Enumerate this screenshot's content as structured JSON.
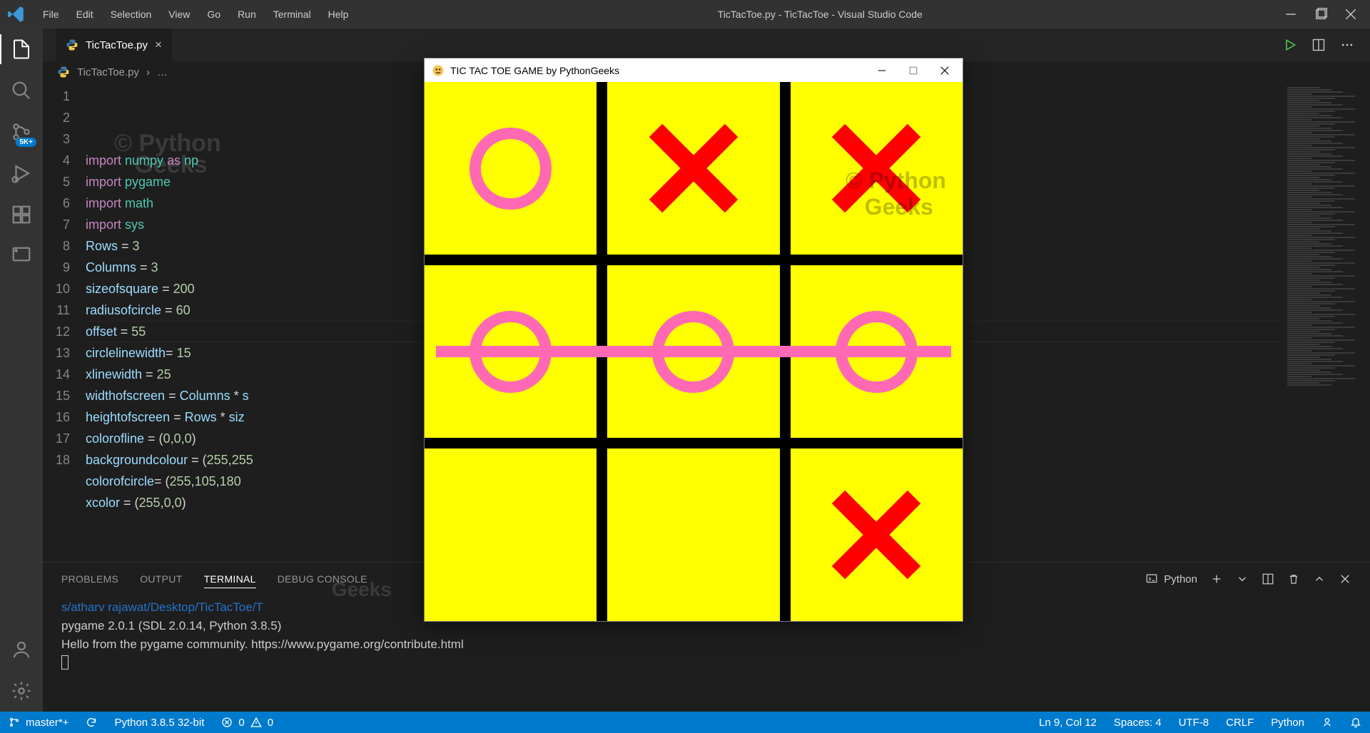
{
  "window": {
    "title": "TicTacToe.py - TicTacToe - Visual Studio Code",
    "menu": [
      "File",
      "Edit",
      "Selection",
      "View",
      "Go",
      "Run",
      "Terminal",
      "Help"
    ]
  },
  "activity": {
    "scm_badge": "5K+"
  },
  "tab": {
    "label": "TicTacToe.py"
  },
  "breadcrumb": {
    "file": "TicTacToe.py",
    "ellipsis": "…"
  },
  "code": {
    "highlight_line": 9,
    "lines": [
      {
        "n": 1,
        "tokens": [
          [
            "key",
            "import "
          ],
          [
            "mod",
            "numpy"
          ],
          [
            "op",
            " "
          ],
          [
            "key",
            "as"
          ],
          [
            "op",
            " "
          ],
          [
            "mod",
            "np"
          ]
        ]
      },
      {
        "n": 2,
        "tokens": [
          [
            "key",
            "import "
          ],
          [
            "mod",
            "pygame"
          ]
        ]
      },
      {
        "n": 3,
        "tokens": [
          [
            "key",
            "import "
          ],
          [
            "mod",
            "math"
          ]
        ]
      },
      {
        "n": 4,
        "tokens": [
          [
            "key",
            "import "
          ],
          [
            "mod",
            "sys"
          ]
        ]
      },
      {
        "n": 5,
        "tokens": [
          [
            "var",
            "Rows"
          ],
          [
            "op",
            " = "
          ],
          [
            "num",
            "3"
          ]
        ]
      },
      {
        "n": 6,
        "tokens": [
          [
            "var",
            "Columns"
          ],
          [
            "op",
            " = "
          ],
          [
            "num",
            "3"
          ]
        ]
      },
      {
        "n": 7,
        "tokens": [
          [
            "var",
            "sizeofsquare"
          ],
          [
            "op",
            " = "
          ],
          [
            "num",
            "200"
          ]
        ]
      },
      {
        "n": 8,
        "tokens": [
          [
            "var",
            "radiusofcircle"
          ],
          [
            "op",
            " = "
          ],
          [
            "num",
            "60"
          ]
        ]
      },
      {
        "n": 9,
        "tokens": [
          [
            "var",
            "offset"
          ],
          [
            "op",
            " = "
          ],
          [
            "num",
            "55"
          ]
        ]
      },
      {
        "n": 10,
        "tokens": [
          [
            "var",
            "circlelinewidth"
          ],
          [
            "op",
            "= "
          ],
          [
            "num",
            "15"
          ]
        ]
      },
      {
        "n": 11,
        "tokens": [
          [
            "var",
            "xlinewidth"
          ],
          [
            "op",
            " = "
          ],
          [
            "num",
            "25"
          ]
        ]
      },
      {
        "n": 12,
        "tokens": [
          [
            "var",
            "widthofscreen"
          ],
          [
            "op",
            " = "
          ],
          [
            "var",
            "Columns"
          ],
          [
            "op",
            " * "
          ],
          [
            "var",
            "s"
          ]
        ]
      },
      {
        "n": 13,
        "tokens": [
          [
            "var",
            "heightofscreen"
          ],
          [
            "op",
            " = "
          ],
          [
            "var",
            "Rows"
          ],
          [
            "op",
            " * "
          ],
          [
            "var",
            "siz"
          ]
        ]
      },
      {
        "n": 14,
        "tokens": [
          [
            "var",
            "colorofline"
          ],
          [
            "op",
            " = ("
          ],
          [
            "num",
            "0"
          ],
          [
            "op",
            ","
          ],
          [
            "num",
            "0"
          ],
          [
            "op",
            ","
          ],
          [
            "num",
            "0"
          ],
          [
            "op",
            ")"
          ]
        ]
      },
      {
        "n": 15,
        "tokens": [
          [
            "var",
            "backgroundcolour"
          ],
          [
            "op",
            " = ("
          ],
          [
            "num",
            "255"
          ],
          [
            "op",
            ","
          ],
          [
            "num",
            "255"
          ]
        ]
      },
      {
        "n": 16,
        "tokens": [
          [
            "var",
            "colorofcircle"
          ],
          [
            "op",
            "= ("
          ],
          [
            "num",
            "255"
          ],
          [
            "op",
            ","
          ],
          [
            "num",
            "105"
          ],
          [
            "op",
            ","
          ],
          [
            "num",
            "180"
          ]
        ]
      },
      {
        "n": 17,
        "tokens": [
          [
            "var",
            "xcolor"
          ],
          [
            "op",
            " = ("
          ],
          [
            "num",
            "255"
          ],
          [
            "op",
            ","
          ],
          [
            "num",
            "0"
          ],
          [
            "op",
            ","
          ],
          [
            "num",
            "0"
          ],
          [
            "op",
            ")"
          ]
        ]
      },
      {
        "n": 18,
        "tokens": []
      }
    ]
  },
  "panel": {
    "tabs": [
      "PROBLEMS",
      "OUTPUT",
      "TERMINAL",
      "DEBUG CONSOLE"
    ],
    "active_tab": 2,
    "dropdown_label": "Python",
    "lines": {
      "path": "s/atharv rajawat/Desktop/TicTacToe/T",
      "pygame": "pygame 2.0.1 (SDL 2.0.14, Python 3.8.5)",
      "hello": "Hello from the pygame community. https://www.pygame.org/contribute.html"
    }
  },
  "status": {
    "branch": "master*+",
    "python": "Python 3.8.5 32-bit",
    "errors": "0",
    "warnings": "0",
    "position": "Ln 9, Col 12",
    "spaces": "Spaces: 4",
    "encoding": "UTF-8",
    "eol": "CRLF",
    "lang": "Python"
  },
  "game": {
    "title": "TIC TAC TOE GAME by PythonGeeks",
    "board": [
      [
        "O",
        "X",
        "X"
      ],
      [
        "O",
        "O",
        "O"
      ],
      [
        "",
        "",
        "X"
      ]
    ],
    "win_row": 1,
    "watermarks": [
      "Python",
      "© Python",
      "Python",
      "Geeks"
    ]
  }
}
